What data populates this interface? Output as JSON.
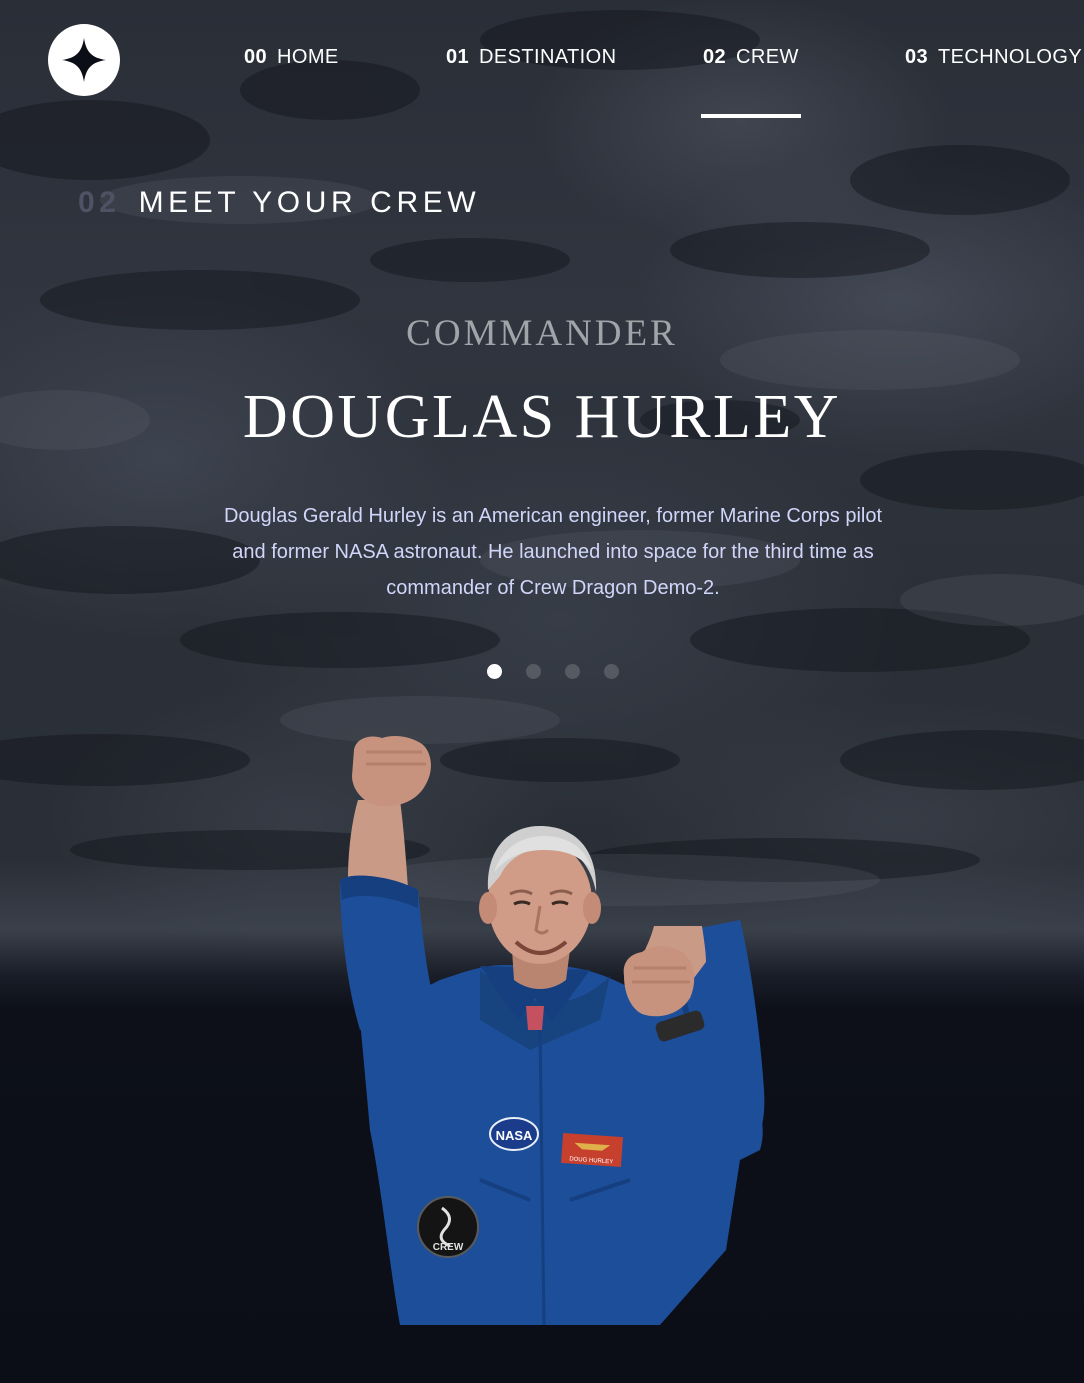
{
  "nav": {
    "items": [
      {
        "number": "00",
        "label": "HOME"
      },
      {
        "number": "01",
        "label": "DESTINATION"
      },
      {
        "number": "02",
        "label": "CREW"
      },
      {
        "number": "03",
        "label": "TECHNOLOGY"
      }
    ],
    "active_index": 2
  },
  "page": {
    "number": "02",
    "title": "MEET YOUR CREW"
  },
  "crew": {
    "role": "COMMANDER",
    "name": "DOUGLAS HURLEY",
    "bio": "Douglas Gerald Hurley is an American engineer, former Marine Corps pilot and former NASA astronaut. He launched into space for the third time as commander of Crew Dragon Demo-2.",
    "badge_label": "NASA",
    "patch_label": "CREW",
    "name_tag": "DOUG HURLEY"
  },
  "carousel": {
    "count": 4,
    "active_index": 0
  },
  "colors": {
    "background": "#0b0d17",
    "accent_text": "#d0d6f9",
    "muted_number": "#4d5264",
    "suit_blue": "#1d4e9a"
  },
  "icons": {
    "logo": "four-point-star-logo-icon"
  }
}
